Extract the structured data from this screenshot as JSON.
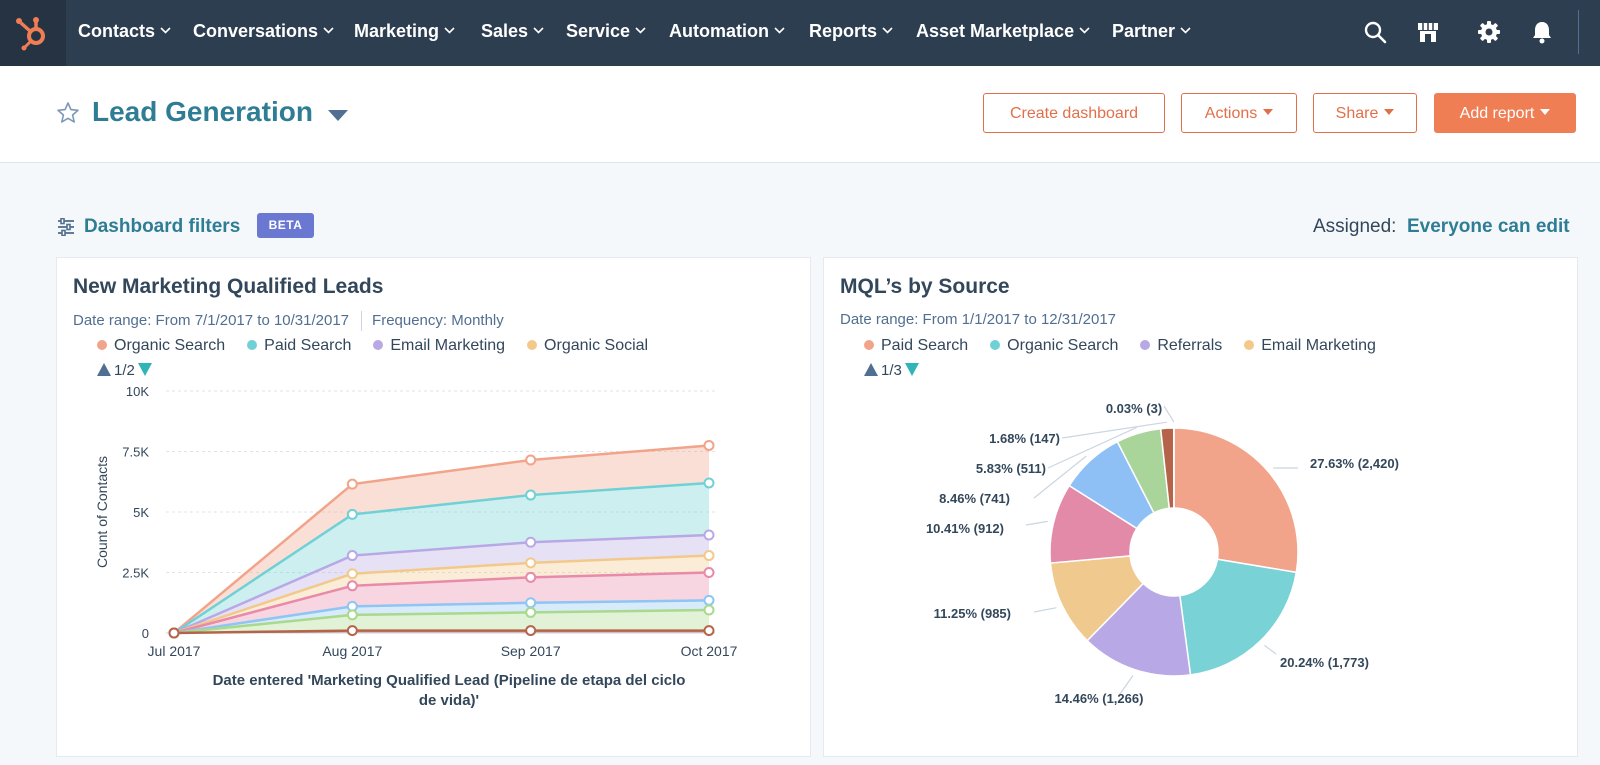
{
  "colors": {
    "nav_bg": "#2d3e50",
    "accent_orange": "#f07e55",
    "link_teal": "#2f7d95",
    "beta_badge": "#6a78d1"
  },
  "nav": {
    "logo": "hubspot-sprocket-icon",
    "items": [
      "Contacts",
      "Conversations",
      "Marketing",
      "Sales",
      "Service",
      "Automation",
      "Reports",
      "Asset Marketplace",
      "Partner"
    ],
    "icons": [
      "search-icon",
      "marketplace-icon",
      "gear-icon",
      "bell-icon"
    ]
  },
  "header": {
    "title": "Lead Generation",
    "buttons": {
      "create_dashboard": "Create dashboard",
      "actions": "Actions",
      "share": "Share",
      "add_report": "Add report"
    }
  },
  "filters": {
    "label": "Dashboard filters",
    "badge": "BETA",
    "assigned_label": "Assigned:",
    "assigned_value": "Everyone can edit"
  },
  "cards": [
    {
      "title": "New Marketing Qualified Leads",
      "date_range": "Date range: From 7/1/2017 to 10/31/2017",
      "frequency": "Frequency: Monthly",
      "legend": [
        {
          "label": "Organic Search",
          "color": "#f2a48b"
        },
        {
          "label": "Paid Search",
          "color": "#6fd1d5"
        },
        {
          "label": "Email Marketing",
          "color": "#b9a8e6"
        },
        {
          "label": "Organic Social",
          "color": "#f2c98b"
        }
      ],
      "pager": "1/2"
    },
    {
      "title": "MQL’s by Source",
      "date_range": "Date range: From 1/1/2017 to 12/31/2017",
      "legend": [
        {
          "label": "Paid Search",
          "color": "#f2a48b"
        },
        {
          "label": "Organic Search",
          "color": "#6fd1d5"
        },
        {
          "label": "Referrals",
          "color": "#b9a8e6"
        },
        {
          "label": "Email Marketing",
          "color": "#f2c98b"
        }
      ],
      "pager": "1/3"
    }
  ],
  "chart_data": [
    {
      "type": "area",
      "stacked": true,
      "categories": [
        "Jul 2017",
        "Aug 2017",
        "Sep 2017",
        "Oct 2017"
      ],
      "ylabel": "Count of Contacts",
      "xlabel": "Date entered 'Marketing Qualified Lead (Pipeline de etapa del ciclo de vida)'",
      "ylim": [
        0,
        10000
      ],
      "yticks": [
        0,
        2500,
        5000,
        7500,
        10000
      ],
      "ytick_labels": [
        "0",
        "2.5K",
        "5K",
        "7.5K",
        "10K"
      ],
      "grid": true,
      "series": [
        {
          "name": "Organic Search",
          "color": "#f2a48b",
          "values": [
            0,
            6150,
            7150,
            7750
          ]
        },
        {
          "name": "Paid Search",
          "color": "#6fd1d5",
          "values": [
            0,
            4900,
            5700,
            6200
          ]
        },
        {
          "name": "Email Marketing",
          "color": "#b9a8e6",
          "values": [
            0,
            3200,
            3750,
            4050
          ]
        },
        {
          "name": "Organic Social",
          "color": "#f2c98b",
          "values": [
            0,
            2450,
            2900,
            3200
          ]
        },
        {
          "color": "#e88aa8",
          "values": [
            0,
            1950,
            2300,
            2500
          ]
        },
        {
          "color": "#8ec5f2",
          "values": [
            0,
            1100,
            1250,
            1350
          ]
        },
        {
          "color": "#a8d98c",
          "values": [
            0,
            750,
            850,
            950
          ]
        },
        {
          "color": "#b5644a",
          "values": [
            0,
            100,
            100,
            100
          ]
        }
      ]
    },
    {
      "type": "pie",
      "donut": true,
      "slices": [
        {
          "label": "27.63% (2,420)",
          "value": 2420,
          "color": "#f2a48b"
        },
        {
          "label": "20.24% (1,773)",
          "value": 1773,
          "color": "#79d2d6"
        },
        {
          "label": "14.46% (1,266)",
          "value": 1266,
          "color": "#b9a8e6"
        },
        {
          "label": "11.25% (985)",
          "value": 985,
          "color": "#f0c98e"
        },
        {
          "label": "10.41% (912)",
          "value": 912,
          "color": "#e28aa8"
        },
        {
          "label": "8.46% (741)",
          "value": 741,
          "color": "#8ec0f5"
        },
        {
          "label": "5.83% (511)",
          "value": 511,
          "color": "#a9d49a"
        },
        {
          "label": "1.68% (147)",
          "value": 147,
          "color": "#b5644a"
        },
        {
          "label": "0.03% (3)",
          "value": 3,
          "color": "#6b6b6b"
        }
      ]
    }
  ]
}
